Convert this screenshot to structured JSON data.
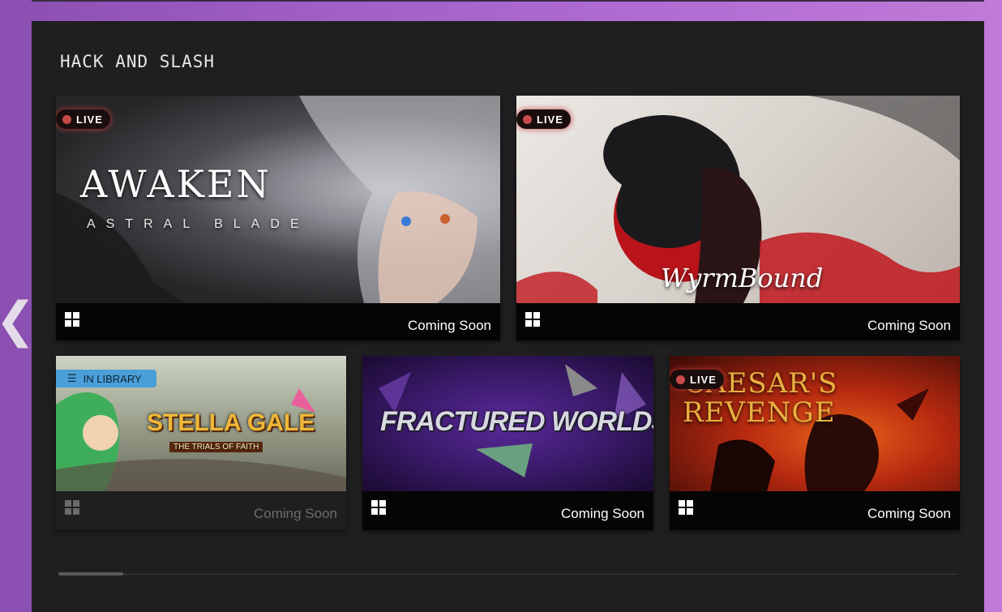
{
  "section": {
    "title": "HACK AND SLASH"
  },
  "nav": {
    "prev_glyph": "❮",
    "next_glyph": "❯"
  },
  "games": [
    {
      "title_line1": "AWAKEN",
      "title_line2": "ASTRAL BLADE",
      "badge": "LIVE",
      "platform_icon": "windows-icon",
      "status": "Coming Soon"
    },
    {
      "title_line1": "WyrmBound",
      "badge": "LIVE",
      "platform_icon": "windows-icon",
      "status": "Coming Soon"
    },
    {
      "title_line1": "STELLA GALE",
      "title_line2": "THE TRIALS OF FAITH",
      "badge": "IN LIBRARY",
      "badge_icon": "list-icon",
      "platform_icon": "windows-icon",
      "status": "Coming Soon"
    },
    {
      "title_line1": "FRACTURED WORLDS",
      "platform_icon": "windows-icon",
      "status": "Coming Soon"
    },
    {
      "title_line1": "CAESAR'S",
      "title_line2": "REVENGE",
      "badge": "LIVE",
      "platform_icon": "windows-icon",
      "status": "Coming Soon"
    }
  ],
  "colors": {
    "live_dot": "#c84a4a",
    "library_badge": "#4a9fd8",
    "panel_bg": "#1f1f20"
  }
}
